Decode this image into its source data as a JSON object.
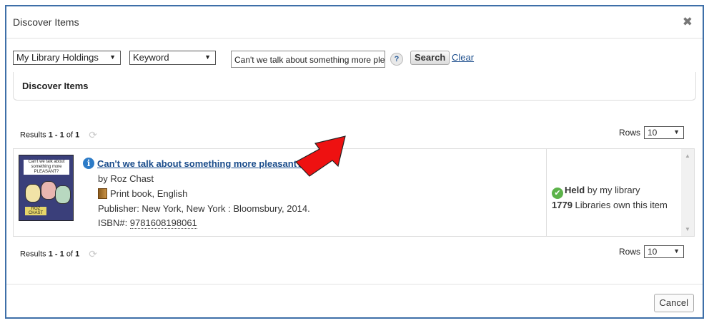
{
  "dialog": {
    "title": "Discover Items",
    "close_symbol": "✖"
  },
  "search": {
    "scope": "My Library Holdings",
    "field": "Keyword",
    "query": "Can't we talk about something more pleasant?",
    "help_symbol": "?",
    "search_label": "Search",
    "clear_label": "Clear"
  },
  "panel": {
    "title": "Discover Items"
  },
  "results": {
    "prefix": "Results ",
    "range": "1 - 1",
    "of": " of ",
    "total": "1",
    "rows_label": "Rows",
    "rows_value": "10"
  },
  "item": {
    "cover_text": "Can't we talk about something more PLEASANT?",
    "cover_author": "ROZ CHAST",
    "title": "Can't we talk about something more pleasant?",
    "author": "by Roz Chast",
    "format": "Print book, English",
    "publisher": "Publisher: New York, New York : Bloomsbury, 2014.",
    "isbn_label": "ISBN#: ",
    "isbn": "9781608198061",
    "held_bold": "Held",
    "held_rest": " by my library",
    "libraries_count": "1779",
    "libraries_text": " Libraries own this item"
  },
  "footer": {
    "cancel_label": "Cancel"
  },
  "colors": {
    "accent": "#3e6fa8",
    "link": "#1a4c8b",
    "annotation_arrow": "#ee1111"
  }
}
